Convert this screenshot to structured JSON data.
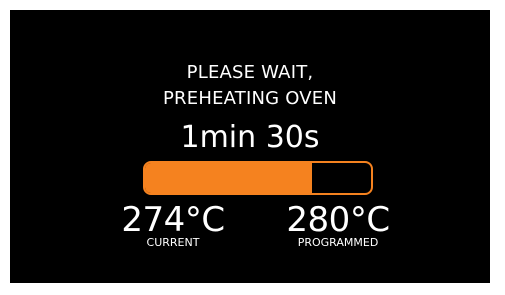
{
  "message": {
    "line1": "PLEASE WAIT,",
    "line2": "PREHEATING OVEN"
  },
  "timer": "1min 30s",
  "progress": {
    "fraction": 0.74,
    "color": "#f5821f"
  },
  "temperature": {
    "current_value": "274°C",
    "current_label": "CURRENT",
    "programmed_value": "280°C",
    "programmed_label": "PROGRAMMED"
  },
  "colors": {
    "background": "#000000",
    "text": "#ffffff",
    "accent": "#f5821f"
  }
}
